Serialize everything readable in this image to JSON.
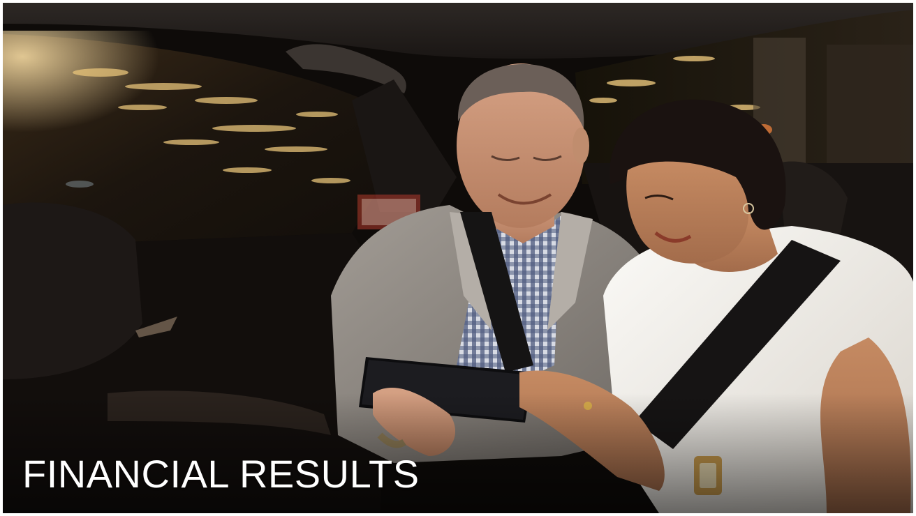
{
  "slide": {
    "title": "FINANCIAL RESULTS"
  },
  "photo": {
    "subject": "couple-in-car-back-seat-looking-at-tablet",
    "colors": {
      "background": "#0b0908",
      "headliner": "#2a2522",
      "window_night": "#1a1510",
      "city_lights": "#e8c47a",
      "jacket": "#8f8a84",
      "shirt_check": "#5b6784",
      "blouse": "#f2f0ec",
      "seatbelt": "#151414",
      "skin": "#c48a66",
      "hair": "#1a1210"
    }
  }
}
